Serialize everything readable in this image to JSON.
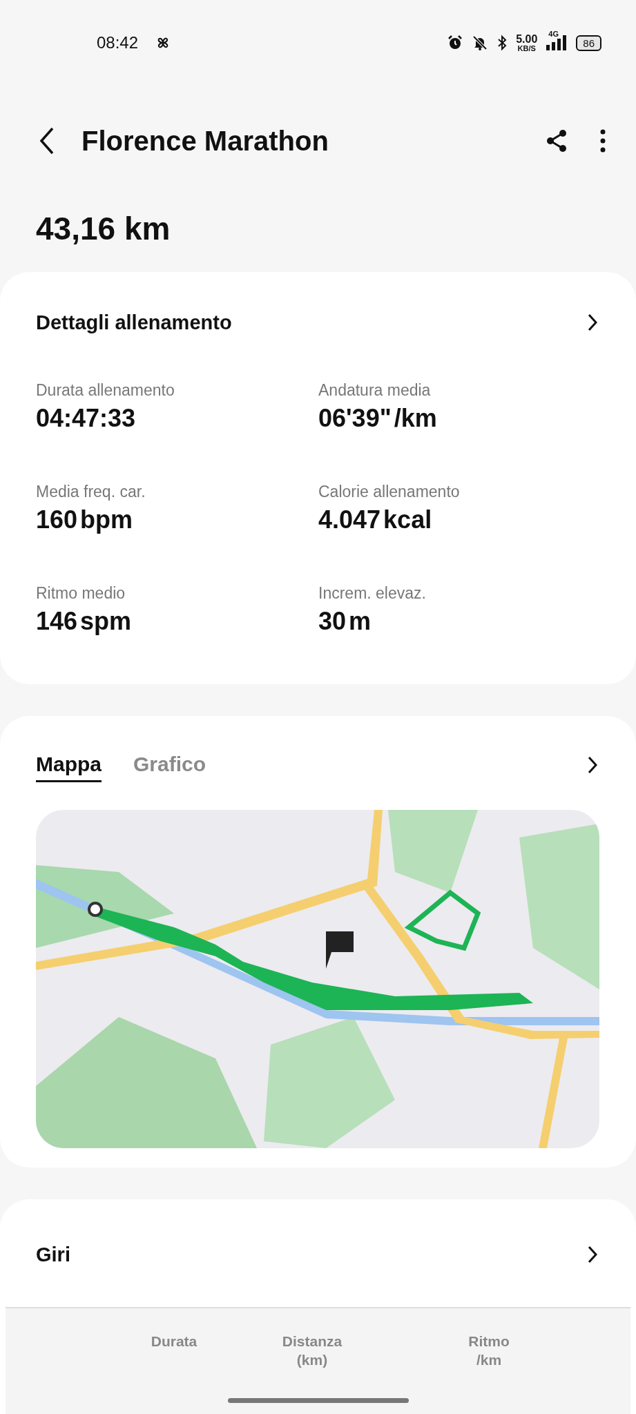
{
  "status_bar": {
    "time": "08:42",
    "net_speed": "5.00",
    "net_unit": "KB/S",
    "network": "4G",
    "battery": "86"
  },
  "header": {
    "title": "Florence Marathon"
  },
  "distance": "43,16 km",
  "details": {
    "title": "Dettagli allenamento",
    "stats": [
      {
        "label": "Durata allenamento",
        "value": "04:47:33"
      },
      {
        "label": "Andatura media",
        "value": "06'39\"",
        "unit": "/km"
      },
      {
        "label": "Media freq. car.",
        "value": "160",
        "unit": "bpm"
      },
      {
        "label": "Calorie allenamento",
        "value": "4.047",
        "unit": "kcal"
      },
      {
        "label": "Ritmo medio",
        "value": "146",
        "unit": "spm"
      },
      {
        "label": "Increm. elevaz.",
        "value": "30",
        "unit": "m"
      }
    ]
  },
  "map_card": {
    "tabs": [
      {
        "label": "Mappa",
        "selected": true
      },
      {
        "label": "Grafico",
        "selected": false
      }
    ]
  },
  "laps": {
    "title": "Giri",
    "columns": [
      "Durata",
      "Distanza\n(km)",
      "Ritmo\n/km"
    ]
  }
}
